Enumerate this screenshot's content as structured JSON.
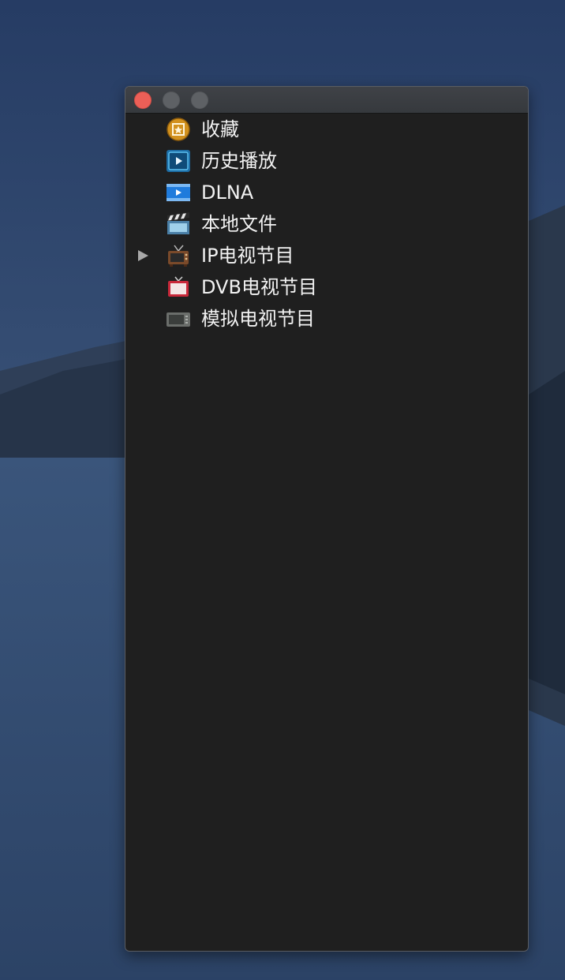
{
  "window": {
    "controls": {
      "close": "close-button",
      "minimize": "minimize-button",
      "zoom": "zoom-button"
    }
  },
  "sidebar": {
    "items": [
      {
        "label": "收藏",
        "icon": "favorites-star-icon"
      },
      {
        "label": "历史播放",
        "icon": "history-play-icon"
      },
      {
        "label": "DLNA",
        "icon": "dlna-play-icon"
      },
      {
        "label": "本地文件",
        "icon": "clapperboard-icon"
      },
      {
        "label": "IP电视节目",
        "icon": "retro-tv-icon",
        "expandable": true
      },
      {
        "label": "DVB电视节目",
        "icon": "red-tv-icon"
      },
      {
        "label": "模拟电视节目",
        "icon": "tv-tuner-icon"
      }
    ]
  },
  "colors": {
    "close": "#ec5f57",
    "inactive_button": "#5e6165",
    "list_bg": "#1f1f1f",
    "text": "#f2f2f2"
  }
}
